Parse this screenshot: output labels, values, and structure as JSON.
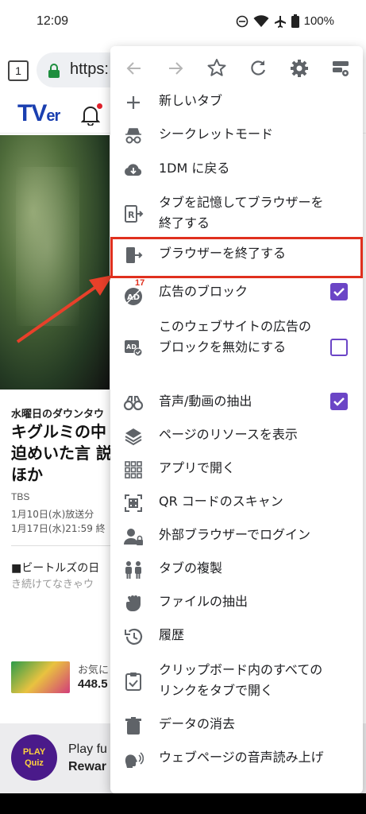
{
  "status_bar": {
    "time": "12:09",
    "battery": "100%"
  },
  "browser": {
    "tab_count": "1",
    "url": "https:"
  },
  "page": {
    "logo_main": "TV",
    "logo_small": "er",
    "weekday_label": "水曜日のダウンタウ",
    "title": "キグルミの中 脅迫めいた言 説 ほか",
    "station": "TBS",
    "date1": "1月10日(水)放送分",
    "date2": "1月17日(水)21:59 終",
    "news_title": "■ビートルズの日",
    "news_sub": "き続けてなきゃウ",
    "ad_label": "お気に",
    "ad_value": "448.5",
    "quiz_logo_line1": "PLAY",
    "quiz_logo_line2": "Quiz",
    "quiz_text1": "Play fu",
    "quiz_text2": "Rewar"
  },
  "menu": {
    "items": [
      {
        "label": "新しいタブ"
      },
      {
        "label": "シークレットモード"
      },
      {
        "label": "1DM に戻る"
      },
      {
        "label": "タブを記憶してブラウザーを終了する"
      },
      {
        "label": "ブラウザーを終了する"
      },
      {
        "label": "広告のブロック",
        "badge": "17",
        "checked": true
      },
      {
        "label": "このウェブサイトの広告のブロックを無効にする",
        "checked": false
      },
      {
        "label": "音声/動画の抽出",
        "checked": true
      },
      {
        "label": "ページのリソースを表示"
      },
      {
        "label": "アプリで開く"
      },
      {
        "label": "QR コードのスキャン"
      },
      {
        "label": "外部ブラウザーでログイン"
      },
      {
        "label": "タブの複製"
      },
      {
        "label": "ファイルの抽出"
      },
      {
        "label": "履歴"
      },
      {
        "label": "クリップボード内のすべてのリンクをタブで開く"
      },
      {
        "label": "データの消去"
      },
      {
        "label": "ウェブページの音声読み上げ"
      }
    ]
  },
  "colors": {
    "accent_purple": "#6b45c6",
    "highlight_red": "#e0301e",
    "icon_gray": "#5f6368"
  }
}
